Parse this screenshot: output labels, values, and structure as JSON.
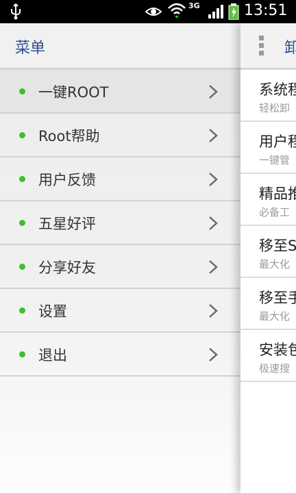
{
  "status_bar": {
    "time": "13:51",
    "network_type": "3G",
    "icons": [
      "usb-icon",
      "eye-icon",
      "wifi-icon",
      "signal-icon",
      "battery-charging-icon"
    ]
  },
  "drawer": {
    "title": "菜单",
    "items": [
      {
        "label": "一键ROOT"
      },
      {
        "label": "Root帮助"
      },
      {
        "label": "用户反馈"
      },
      {
        "label": "五星好评"
      },
      {
        "label": "分享好友"
      },
      {
        "label": "设置"
      },
      {
        "label": "退出"
      }
    ]
  },
  "panel": {
    "title": "卸",
    "items": [
      {
        "title": "系统程",
        "subtitle": "轻松卸"
      },
      {
        "title": "用户程",
        "subtitle": "一键管"
      },
      {
        "title": "精品推",
        "subtitle": "必备工"
      },
      {
        "title": "移至S",
        "subtitle": "最大化"
      },
      {
        "title": "移至手",
        "subtitle": "最大化"
      },
      {
        "title": "安装包",
        "subtitle": "极速搜"
      }
    ]
  },
  "colors": {
    "accent": "#2d4f90",
    "dot": "#3cbf2d",
    "status_bar": "#000000"
  }
}
